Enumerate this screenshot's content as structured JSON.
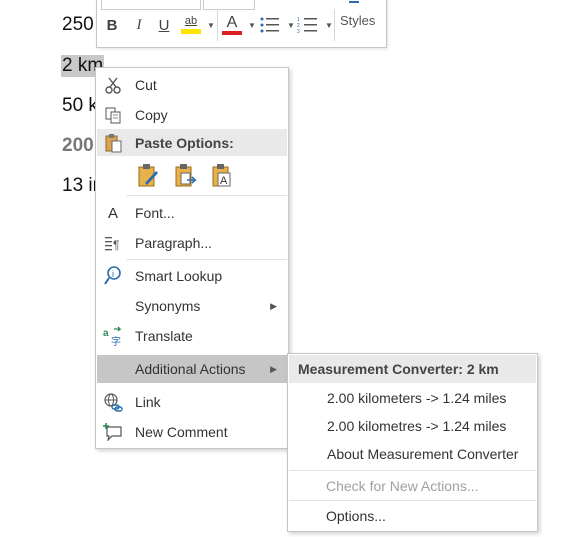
{
  "document": {
    "lines": [
      "250",
      "2 km",
      "50 k",
      "200",
      "13 in"
    ]
  },
  "mini_toolbar": {
    "bold_label": "B",
    "italic_label": "I",
    "underline_label": "U",
    "highlight_label": "ab",
    "font_color_label": "A",
    "styles_label": "Styles",
    "highlight_color": "#ffe600",
    "font_color": "#e02020"
  },
  "context_menu": {
    "cut": "Cut",
    "copy": "Copy",
    "paste_options": "Paste Options:",
    "font": "Font...",
    "paragraph": "Paragraph...",
    "smart_lookup": "Smart Lookup",
    "synonyms": "Synonyms",
    "translate": "Translate",
    "additional_actions": "Additional Actions",
    "link": "Link",
    "new_comment": "New Comment"
  },
  "submenu": {
    "header": "Measurement Converter: 2 km",
    "items": [
      "2.00 kilometers -> 1.24 miles",
      "2.00 kilometres -> 1.24 miles",
      "About Measurement Converter"
    ],
    "check_actions": "Check for New Actions...",
    "options": "Options..."
  },
  "colors": {
    "highlight_bg": "#c6c6c6",
    "header_bg": "#e9e9e9",
    "icon_blue": "#2b6cb0",
    "icon_orange": "#d9822b"
  }
}
